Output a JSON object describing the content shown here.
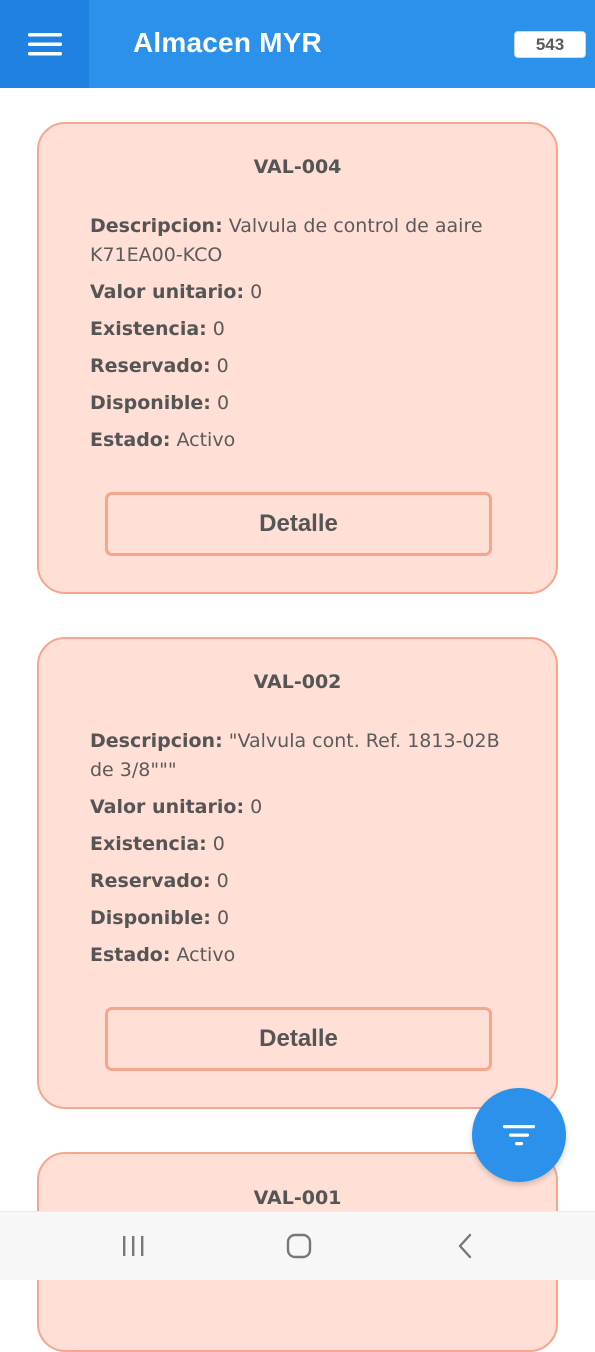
{
  "header": {
    "title": "Almacen MYR",
    "count": "543"
  },
  "labels": {
    "descripcion": "Descripcion:",
    "valor_unitario": "Valor unitario:",
    "existencia": "Existencia:",
    "reservado": "Reservado:",
    "disponible": "Disponible:",
    "estado": "Estado:"
  },
  "items": [
    {
      "code": "VAL-004",
      "descripcion": "Valvula de control de aaire K71EA00-KCO",
      "valor_unitario": "0",
      "existencia": "0",
      "reservado": "0",
      "disponible": "0",
      "estado": "Activo",
      "button_label": "Detalle"
    },
    {
      "code": "VAL-002",
      "descripcion": "\"Valvula cont. Ref. 1813-02B de 3/8\"\"\"",
      "valor_unitario": "0",
      "existencia": "0",
      "reservado": "0",
      "disponible": "0",
      "estado": "Activo",
      "button_label": "Detalle"
    },
    {
      "code": "VAL-001"
    }
  ],
  "icons": {
    "menu": "menu-icon",
    "filter": "filter-icon",
    "recents": "recent-apps-icon",
    "home": "home-icon",
    "back": "back-icon"
  },
  "colors": {
    "primary": "#2b91ea",
    "card_background": "#ffdfd6",
    "card_border": "#f5a68c"
  }
}
